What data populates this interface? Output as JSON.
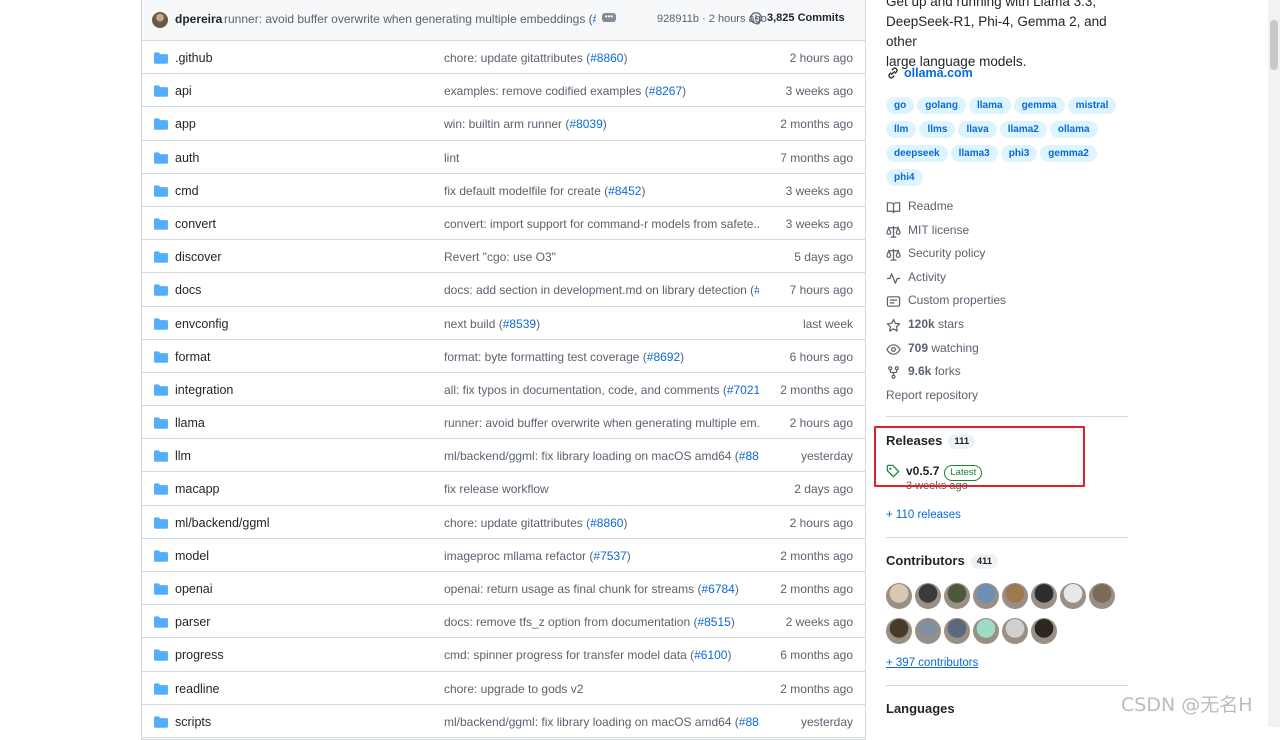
{
  "latest_commit": {
    "author": "dpereira",
    "message": "runner: avoid buffer overwrite when generating multiple embeddings (",
    "message_ref": "#...",
    "sha_time": "928911b · 2 hours ago",
    "commits": "3,825 Commits"
  },
  "files": [
    {
      "name": ".github",
      "msg": "chore: update gitattributes (",
      "ref": "#8860",
      "tail": ")",
      "age": "2 hours ago"
    },
    {
      "name": "api",
      "msg": "examples: remove codified examples (",
      "ref": "#8267",
      "tail": ")",
      "age": "3 weeks ago"
    },
    {
      "name": "app",
      "msg": "win: builtin arm runner (",
      "ref": "#8039",
      "tail": ")",
      "age": "2 months ago"
    },
    {
      "name": "auth",
      "msg": "lint",
      "ref": "",
      "tail": "",
      "age": "7 months ago"
    },
    {
      "name": "cmd",
      "msg": "fix default modelfile for create (",
      "ref": "#8452",
      "tail": ")",
      "age": "3 weeks ago"
    },
    {
      "name": "convert",
      "msg": "convert: import support for command-r models from safete...",
      "ref": "",
      "tail": "",
      "age": "3 weeks ago"
    },
    {
      "name": "discover",
      "msg": "Revert \"cgo: use O3\"",
      "ref": "",
      "tail": "",
      "age": "5 days ago"
    },
    {
      "name": "docs",
      "msg": "docs: add section in development.md on library detection (",
      "ref": "#...",
      "tail": "",
      "age": "7 hours ago"
    },
    {
      "name": "envconfig",
      "msg": "next build (",
      "ref": "#8539",
      "tail": ")",
      "age": "last week"
    },
    {
      "name": "format",
      "msg": "format: byte formatting test coverage (",
      "ref": "#8692",
      "tail": ")",
      "age": "6 hours ago"
    },
    {
      "name": "integration",
      "msg": "all: fix typos in documentation, code, and comments (",
      "ref": "#7021",
      "tail": ")",
      "age": "2 months ago"
    },
    {
      "name": "llama",
      "msg": "runner: avoid buffer overwrite when generating multiple em...",
      "ref": "",
      "tail": "",
      "age": "2 hours ago"
    },
    {
      "name": "llm",
      "msg": "ml/backend/ggml: fix library loading on macOS amd64 (",
      "ref": "#88...",
      "tail": "",
      "age": "yesterday"
    },
    {
      "name": "macapp",
      "msg": "fix release workflow",
      "ref": "",
      "tail": "",
      "age": "2 days ago"
    },
    {
      "name": "ml/backend/ggml",
      "msg": "chore: update gitattributes (",
      "ref": "#8860",
      "tail": ")",
      "age": "2 hours ago"
    },
    {
      "name": "model",
      "msg": "imageproc mllama refactor (",
      "ref": "#7537",
      "tail": ")",
      "age": "2 months ago"
    },
    {
      "name": "openai",
      "msg": "openai: return usage as final chunk for streams (",
      "ref": "#6784",
      "tail": ")",
      "age": "2 months ago"
    },
    {
      "name": "parser",
      "msg": "docs: remove tfs_z option from documentation (",
      "ref": "#8515",
      "tail": ")",
      "age": "2 weeks ago"
    },
    {
      "name": "progress",
      "msg": "cmd: spinner progress for transfer model data (",
      "ref": "#6100",
      "tail": ")",
      "age": "6 months ago"
    },
    {
      "name": "readline",
      "msg": "chore: upgrade to gods v2",
      "ref": "",
      "tail": "",
      "age": "2 months ago"
    },
    {
      "name": "scripts",
      "msg": "ml/backend/ggml: fix library loading on macOS amd64 (",
      "ref": "#88...",
      "tail": "",
      "age": "yesterday"
    }
  ],
  "about": {
    "line1": "Get up and running with Llama 3.3,",
    "line2": "DeepSeek-R1, Phi-4, Gemma 2, and other",
    "line3": "large language models.",
    "homepage": "ollama.com"
  },
  "topics": [
    "go",
    "golang",
    "llama",
    "gemma",
    "mistral",
    "llm",
    "llms",
    "llava",
    "llama2",
    "ollama",
    "deepseek",
    "llama3",
    "phi3",
    "gemma2",
    "phi4"
  ],
  "meta": {
    "readme": "Readme",
    "license": "MIT license",
    "security": "Security policy",
    "activity": "Activity",
    "custom": "Custom properties",
    "stars_count": "120k",
    "stars_label": "stars",
    "watching_count": "709",
    "watching_label": "watching",
    "forks_count": "9.6k",
    "forks_label": "forks",
    "report": "Report repository"
  },
  "releases": {
    "heading": "Releases",
    "count": "111",
    "tag": "v0.5.7",
    "latest_label": "Latest",
    "date": "3 weeks ago",
    "more": "+ 110 releases"
  },
  "contributors": {
    "heading": "Contributors",
    "count": "411",
    "more": "+ 397 contributors",
    "avatar_colors": [
      "#d9c9b0",
      "#3a3a3a",
      "#4a5a3a",
      "#6b8fb8",
      "#a07850",
      "#2d2d2d",
      "#e8e8e8",
      "#7a6a5a",
      "#4a3a2a",
      "#8090a0",
      "#5a6a7a",
      "#9fdcc8",
      "#d0d0d0",
      "#2a2620"
    ]
  },
  "languages_heading": "Languages",
  "watermark": "CSDN @无名H",
  "colors": {
    "link": "#0969da",
    "border": "#d1d9e0",
    "muted": "#59636e",
    "topic_bg": "#ddf4ff",
    "highlight": "#e0202a",
    "latest_green": "#1a7f37"
  }
}
